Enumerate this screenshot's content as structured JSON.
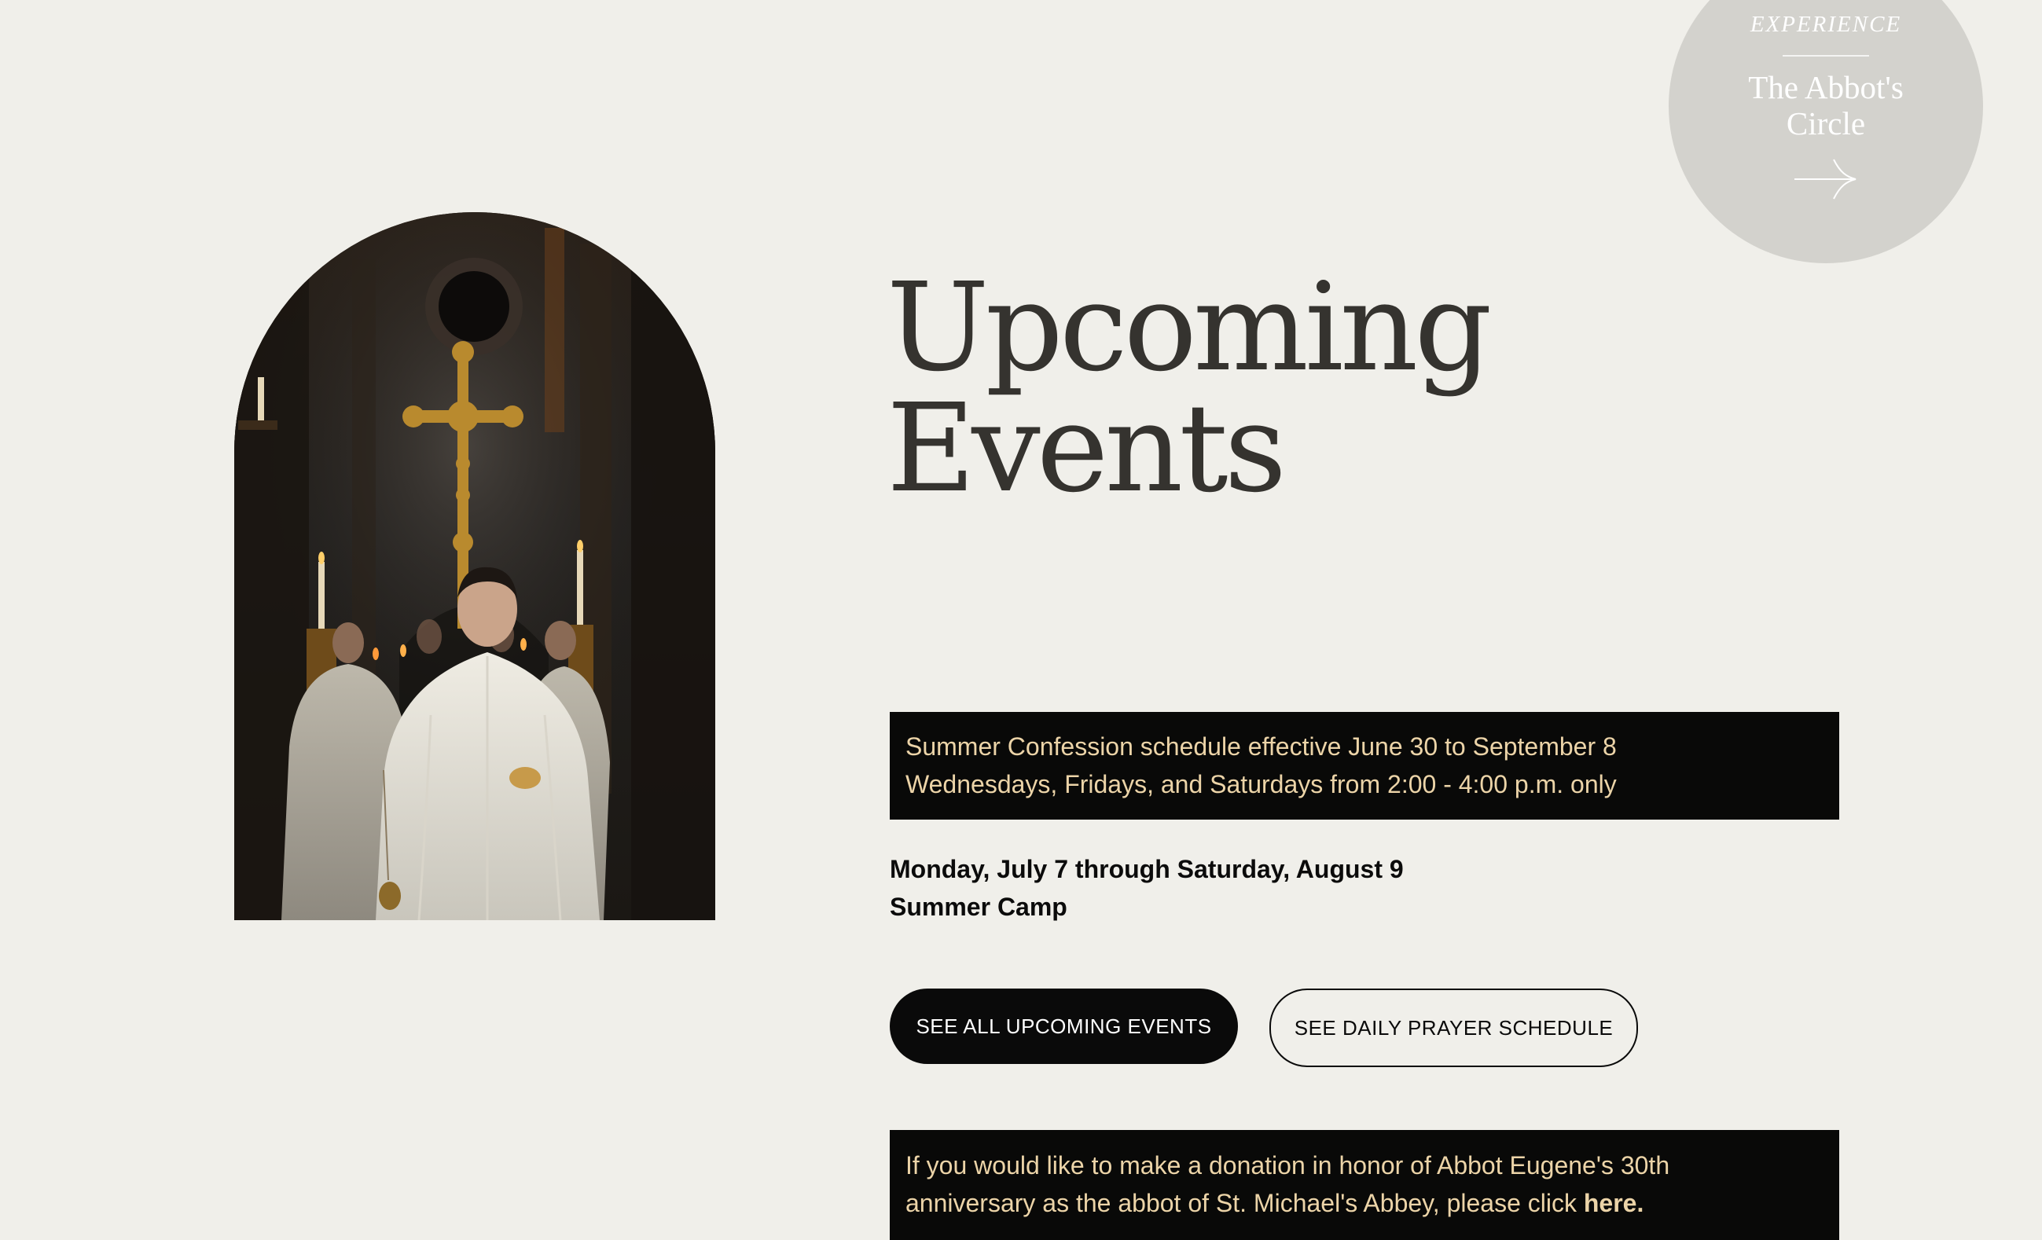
{
  "colors": {
    "background": "#f0efea",
    "notice_bg": "#090908",
    "notice_text": "#ecd4a8",
    "circle_bg": "#d3d2cd",
    "heading": "#35332f"
  },
  "abbot_circle": {
    "kicker": "EXPERIENCE",
    "title_line1": "The Abbot's",
    "title_line2": "Circle",
    "icon": "arrow-right-icon"
  },
  "hero_image": {
    "icon": "procession-photo"
  },
  "heading": {
    "line1": "Upcoming",
    "line2": "Events"
  },
  "confession_notice": {
    "line1": "Summer Confession schedule effective June 30 to September 8",
    "line2": "Wednesdays, Fridays, and Saturdays from 2:00 - 4:00 p.m. only"
  },
  "event": {
    "date": "Monday, July 7 through Saturday, August 9",
    "title": "Summer Camp"
  },
  "buttons": {
    "all_events": "SEE ALL UPCOMING EVENTS",
    "prayer_schedule": "SEE DAILY PRAYER SCHEDULE"
  },
  "donation_notice": {
    "line1": "If you would like to make a donation in honor of Abbot Eugene's 30th",
    "line2_prefix": "anniversary as the abbot of St. Michael's Abbey, please click ",
    "link": "here."
  }
}
